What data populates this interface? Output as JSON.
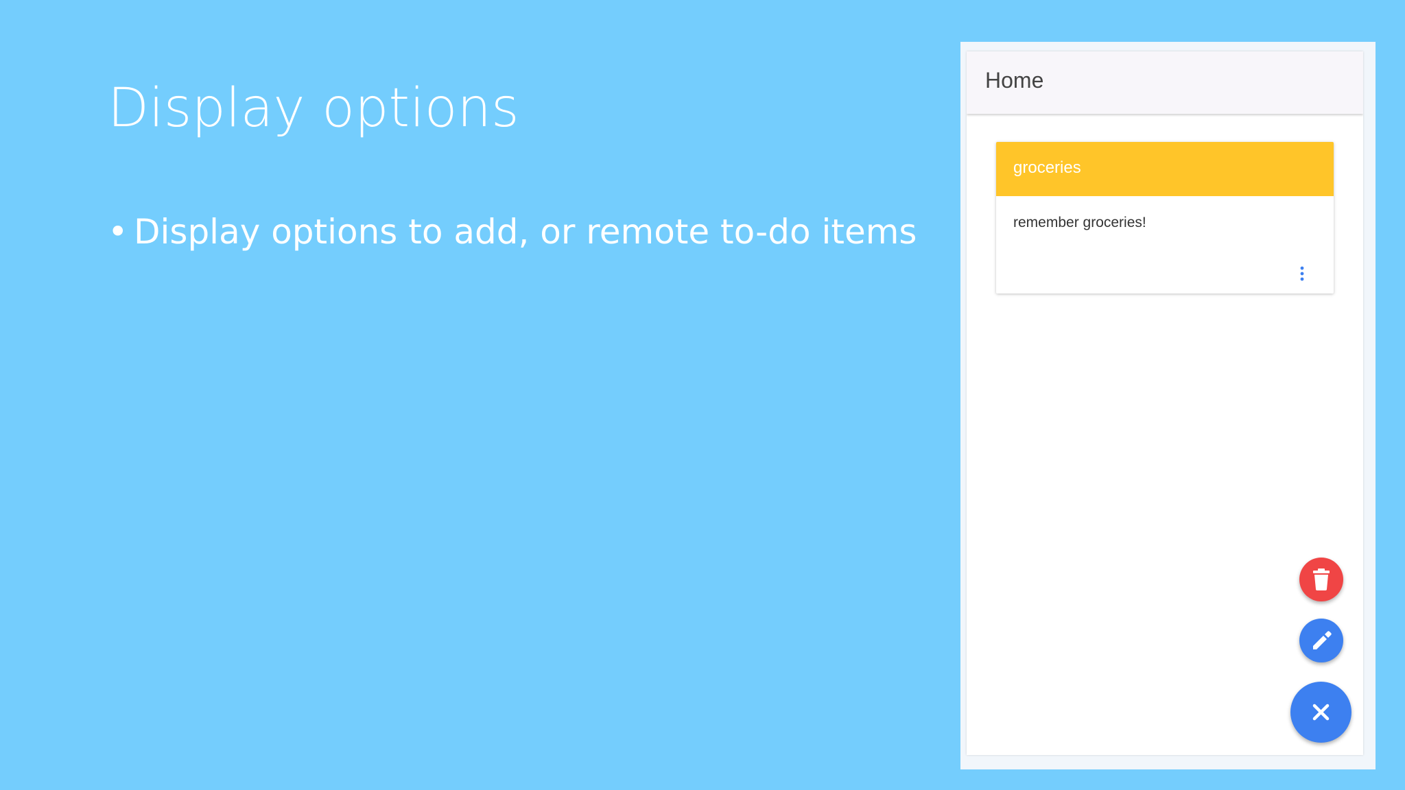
{
  "slide": {
    "title": "Display options",
    "bullets": [
      "Display options to add, or remote to-do items"
    ]
  },
  "app": {
    "app_bar": {
      "title": "Home"
    },
    "card": {
      "title": "groceries",
      "body": "remember groceries!",
      "menu_icon": "more-vertical-icon"
    },
    "fabs": [
      {
        "icon": "trash-icon",
        "color": "#F04545"
      },
      {
        "icon": "pencil-icon",
        "color": "#3D80F0"
      },
      {
        "icon": "close-icon",
        "color": "#3D80F0"
      }
    ]
  },
  "colors": {
    "background": "#74CDFD",
    "card_header": "#FFC529",
    "accent_blue": "#3D80F0",
    "delete_red": "#F04545"
  }
}
